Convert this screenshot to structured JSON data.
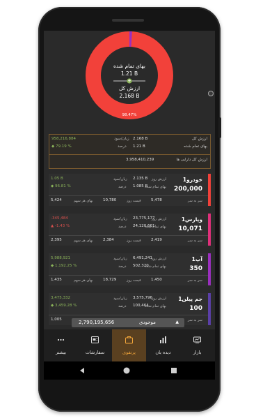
{
  "donut": {
    "cost_label": "بهای تمام شده",
    "cost_value": "1.21 B",
    "total_label": "ارزش کل",
    "total_value": "2.168 B",
    "percent": "98.47%",
    "fill_fraction": 0.9847,
    "main_color": "#f2413a",
    "accent_color": "#9b2fbf"
  },
  "summary": {
    "total_value_label": "ارزش کل",
    "total_value": "2.168 B",
    "profit_loss_label": "زیان/سود",
    "profit_value": "958,216,884",
    "cost_label": "بهای تمام شده",
    "cost_value": "1.21 B",
    "percent_label": "درصد",
    "percent_value": "79.19 %",
    "assets_label": "ارزش کل دارایی ها",
    "assets_value": "3,958,410,239"
  },
  "labels": {
    "day_value": "ارزش روز",
    "profit_loss": "زیان/سود",
    "cost": "بهای تمام شده",
    "percent": "درصد",
    "break_even": "سر به سر",
    "day_price": "قیمت روز",
    "avg_share_cost": "بهای هر سهم"
  },
  "stocks": [
    {
      "symbol": "خودرو1",
      "qty": "200,000",
      "day_value": "2.135 B",
      "profit": "1.05 B",
      "cost": "1.085 B",
      "percent": "96.81 %",
      "trend": "up",
      "break_even": "5,424",
      "day_price": "10,780",
      "avg_cost": "5,478",
      "color": "#f2413a"
    },
    {
      "symbol": "وپارس1",
      "qty": "10,071",
      "day_value": "23,775,177",
      "profit": "-345,484",
      "cost": "24,120,661",
      "percent": "-1.43 %",
      "trend": "down",
      "break_even": "2,395",
      "day_price": "2,384",
      "avg_cost": "2,419",
      "color": "#e0307b"
    },
    {
      "symbol": "آپ1",
      "qty": "350",
      "day_value": "6,491,241",
      "profit": "5,988,921",
      "cost": "502,320",
      "percent": "1,192.25 %",
      "trend": "up",
      "break_even": "1,435",
      "day_price": "18,729",
      "avg_cost": "1,450",
      "color": "#9b2fbf"
    },
    {
      "symbol": "جم پیلن1",
      "qty": "100",
      "day_value": "3,575,796",
      "profit": "3,475,332",
      "cost": "100,464",
      "percent": "3,459.28 %",
      "trend": "up",
      "break_even": "1,005",
      "day_price": "",
      "avg_cost": "",
      "color": "#5b3fa8"
    }
  ],
  "total_bar": {
    "label": "موجودی",
    "value": "2,790,195,656"
  },
  "nav": [
    {
      "label": "بازار",
      "icon": "market-icon"
    },
    {
      "label": "دیده بان",
      "icon": "watchlist-chart-icon"
    },
    {
      "label": "پرتفوی",
      "icon": "portfolio-briefcase-icon",
      "active": true
    },
    {
      "label": "سفارشات",
      "icon": "orders-icon"
    },
    {
      "label": "بیشتر",
      "icon": "more-dots-icon"
    }
  ],
  "colors": {
    "accent": "#f0a43a",
    "positive": "#8bb35a",
    "negative": "#d6504d",
    "background": "#2a2a2a"
  }
}
